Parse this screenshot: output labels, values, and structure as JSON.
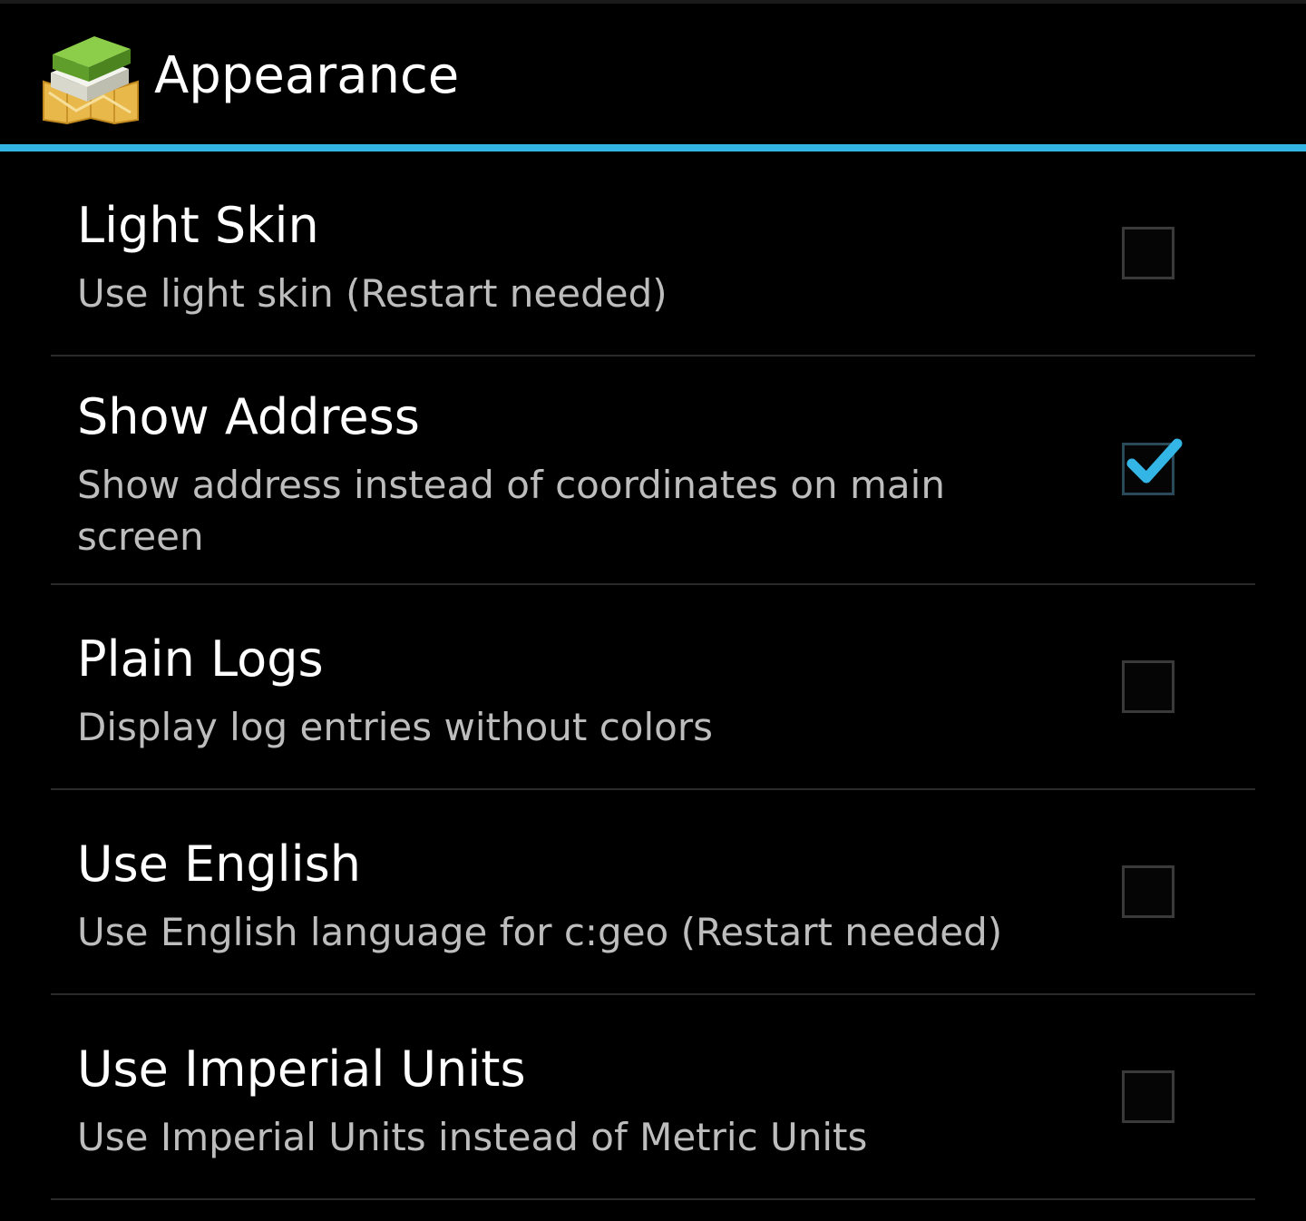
{
  "action_bar": {
    "title": "Appearance",
    "icon": "cgeo-app-icon"
  },
  "colors": {
    "background": "#000000",
    "accent": "#33b5e5",
    "title_text": "#ffffff",
    "summary_text": "#bdbdbd",
    "divider": "#2a2a2a"
  },
  "preferences": [
    {
      "title": "Light Skin",
      "summary": "Use light skin (Restart needed)",
      "checked": false
    },
    {
      "title": "Show Address",
      "summary": "Show address instead of coordinates on main screen",
      "checked": true
    },
    {
      "title": "Plain Logs",
      "summary": "Display log entries without colors",
      "checked": false
    },
    {
      "title": "Use English",
      "summary": "Use English language for c:geo (Restart needed)",
      "checked": false
    },
    {
      "title": "Use Imperial Units",
      "summary": "Use Imperial Units instead of Metric Units",
      "checked": false
    }
  ]
}
